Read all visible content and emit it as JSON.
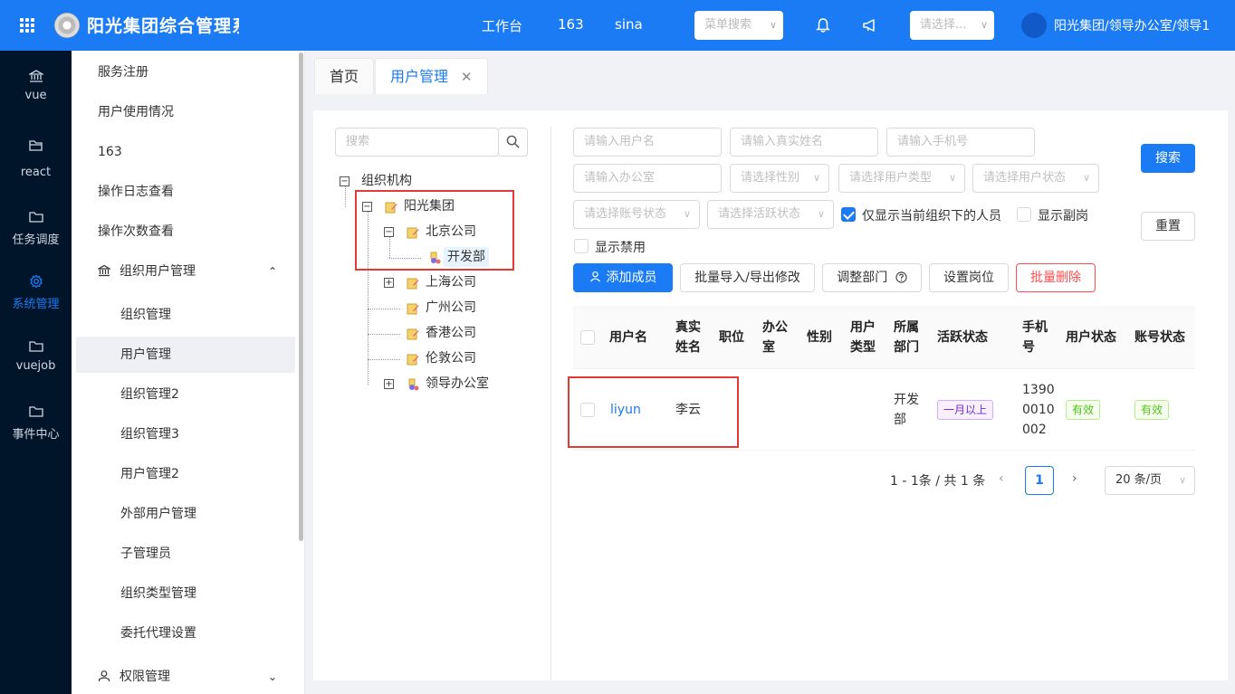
{
  "header": {
    "app_title": "阳光集团综合管理系统",
    "nav_links": [
      "工作台",
      "163",
      "sina"
    ],
    "menu_search_placeholder": "菜单搜索",
    "org_select_placeholder": "请选择...",
    "user_path": "阳光集团/领导办公室/领导1",
    "brand_color": "#1a7bf5"
  },
  "leftnav": {
    "items": [
      {
        "label": "vue",
        "icon": "bank-icon"
      },
      {
        "label": "react",
        "icon": "folder-open-icon"
      },
      {
        "label": "任务调度",
        "icon": "folder-icon"
      },
      {
        "label": "系统管理",
        "icon": "gear-icon"
      },
      {
        "label": "vuejob",
        "icon": "folder-icon"
      },
      {
        "label": "事件中心",
        "icon": "folder-icon"
      }
    ],
    "active": "系统管理"
  },
  "submenu": {
    "items": [
      "服务注册",
      "用户使用情况",
      "163",
      "操作日志查看",
      "操作次数查看",
      "组织用户管理",
      "组织管理",
      "用户管理",
      "组织管理2",
      "组织管理3",
      "用户管理2",
      "外部用户管理",
      "子管理员",
      "组织类型管理",
      "委托代理设置",
      "权限管理"
    ],
    "selected": "用户管理"
  },
  "tabs": [
    {
      "label": "首页"
    },
    {
      "label": "用户管理",
      "closable": true
    }
  ],
  "tree": {
    "search_placeholder": "搜索",
    "root": "组织机构",
    "nodes": {
      "group": "阳光集团",
      "beijing": "北京公司",
      "dev": "开发部",
      "shanghai": "上海公司",
      "guangzhou": "广州公司",
      "hongkong": "香港公司",
      "london": "伦敦公司",
      "leader_office": "领导办公室"
    }
  },
  "filters": {
    "username": "请输入用户名",
    "realname": "请输入真实姓名",
    "phone": "请输入手机号",
    "office": "请输入办公室",
    "gender": "请选择性别",
    "user_type": "请选择用户类型",
    "user_status": "请选择用户状态",
    "account_status": "请选择账号状态",
    "active_status": "请选择活跃状态",
    "only_current_org": "仅显示当前组织下的人员",
    "show_deputy": "显示副岗",
    "show_disabled": "显示禁用",
    "search_btn": "搜索",
    "reset_btn": "重置"
  },
  "actions": {
    "add_member": "添加成员",
    "batch_import": "批量导入/导出修改",
    "adjust_dept": "调整部门",
    "set_post": "设置岗位",
    "batch_delete": "批量删除"
  },
  "table": {
    "columns": [
      "用户名",
      "真实姓名",
      "职位",
      "办公室",
      "性别",
      "用户类型",
      "所属部门",
      "活跃状态",
      "手机号",
      "用户状态",
      "账号状态"
    ],
    "rows": [
      {
        "username": "liyun",
        "realname": "李云",
        "position": "",
        "office": "",
        "gender": "",
        "user_type": "",
        "dept": "开发部",
        "active_status": "一月以上",
        "phone": "13900010002",
        "user_status": "有效",
        "account_status": "有效"
      }
    ]
  },
  "pagination": {
    "summary": "1 - 1条 / 共 1 条",
    "current_page": "1",
    "page_size": "20 条/页"
  }
}
